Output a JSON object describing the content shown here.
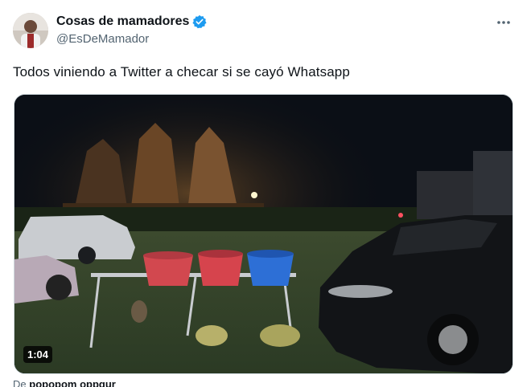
{
  "author": {
    "display_name": "Cosas de mamadores",
    "handle": "@EsDeMamador",
    "verified": true
  },
  "tweet": {
    "text": "Todos viniendo a Twitter a checar si se cayó Whatsapp"
  },
  "video": {
    "duration": "1:04"
  },
  "footer": {
    "prefix": "De",
    "source": "popopom oppgur"
  },
  "colors": {
    "verified_blue": "#1d9bf0",
    "text_primary": "#0f1419",
    "text_secondary": "#536471"
  },
  "icons": {
    "verified": "verified-badge-icon",
    "more": "more-options-icon"
  }
}
